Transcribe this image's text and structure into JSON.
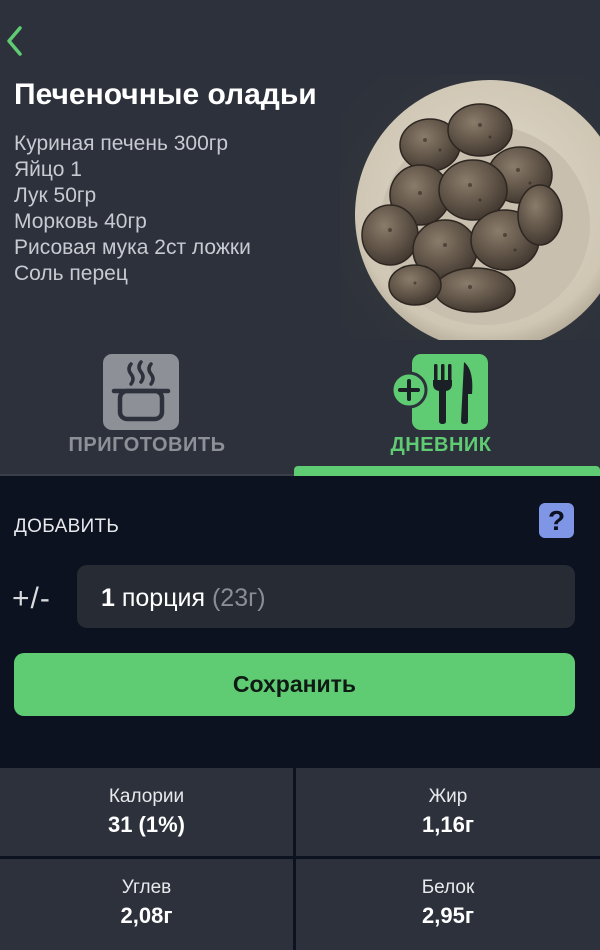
{
  "recipe": {
    "title": "Печеночные оладьи",
    "ingredients": [
      "Куриная печень 300гр",
      "Яйцо 1",
      "Лук 50гр",
      "Морковь 40гр",
      "Рисовая мука 2ст ложки",
      "Соль перец"
    ]
  },
  "tabs": {
    "cook": {
      "label": "ПРИГОТОВИТЬ",
      "icon": "cooking-pot-icon"
    },
    "diary": {
      "label": "ДНЕВНИК",
      "icon": "add-meal-icon",
      "active": true
    }
  },
  "add": {
    "label": "ДОБАВИТЬ",
    "help": "?",
    "plus_minus": "+/-",
    "portion_qty": "1",
    "portion_unit": "порция",
    "portion_grams": "(23г)"
  },
  "save_label": "Сохранить",
  "stats": [
    {
      "label": "Калории",
      "value": "31 (1%)"
    },
    {
      "label": "Жир",
      "value": "1,16г"
    },
    {
      "label": "Углев",
      "value": "2,08г"
    },
    {
      "label": "Белок",
      "value": "2,95г"
    }
  ],
  "colors": {
    "accent": "#5fcb72",
    "background": "#0c1220",
    "panel": "#2c313b",
    "help": "#7f95e6"
  }
}
